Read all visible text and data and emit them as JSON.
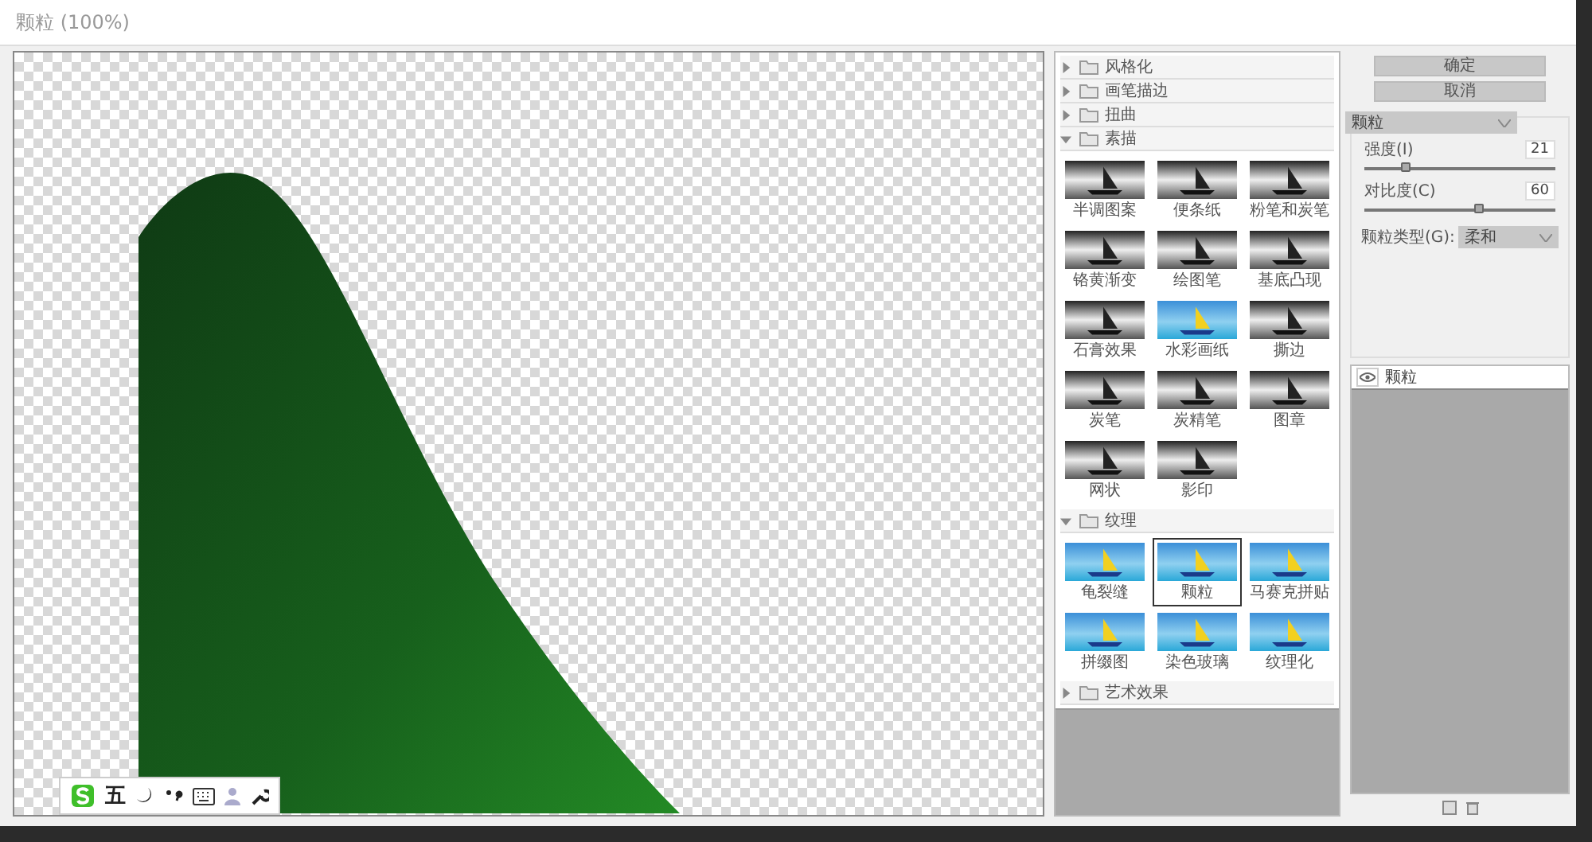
{
  "window": {
    "title": "颗粒 (100%)"
  },
  "filter_groups": [
    {
      "name": "风格化",
      "expanded": false
    },
    {
      "name": "画笔描边",
      "expanded": false
    },
    {
      "name": "扭曲",
      "expanded": false
    },
    {
      "name": "素描",
      "expanded": true,
      "items": [
        {
          "label": "半调图案",
          "kind": "mono",
          "selected": false
        },
        {
          "label": "便条纸",
          "kind": "mono",
          "selected": false
        },
        {
          "label": "粉笔和炭笔",
          "kind": "mono",
          "selected": false
        },
        {
          "label": "铬黄渐变",
          "kind": "mono",
          "selected": false
        },
        {
          "label": "绘图笔",
          "kind": "mono",
          "selected": false
        },
        {
          "label": "基底凸现",
          "kind": "mono",
          "selected": false
        },
        {
          "label": "石膏效果",
          "kind": "mono",
          "selected": false
        },
        {
          "label": "水彩画纸",
          "kind": "color",
          "selected": false
        },
        {
          "label": "撕边",
          "kind": "mono",
          "selected": false
        },
        {
          "label": "炭笔",
          "kind": "mono",
          "selected": false
        },
        {
          "label": "炭精笔",
          "kind": "mono",
          "selected": false
        },
        {
          "label": "图章",
          "kind": "mono",
          "selected": false
        },
        {
          "label": "网状",
          "kind": "mono",
          "selected": false
        },
        {
          "label": "影印",
          "kind": "mono",
          "selected": false
        }
      ]
    },
    {
      "name": "纹理",
      "expanded": true,
      "items": [
        {
          "label": "龟裂缝",
          "kind": "color",
          "selected": false
        },
        {
          "label": "颗粒",
          "kind": "color",
          "selected": true
        },
        {
          "label": "马赛克拼贴",
          "kind": "color",
          "selected": false
        },
        {
          "label": "拼缀图",
          "kind": "color",
          "selected": false
        },
        {
          "label": "染色玻璃",
          "kind": "color",
          "selected": false
        },
        {
          "label": "纹理化",
          "kind": "color",
          "selected": false
        }
      ]
    },
    {
      "name": "艺术效果",
      "expanded": false
    }
  ],
  "buttons": [
    "确定",
    "取消"
  ],
  "filter_select": "颗粒",
  "params": [
    {
      "label": "强度(I)",
      "value": "21",
      "level": 0.22
    },
    {
      "label": "对比度(C)",
      "value": "60",
      "level": 0.6
    }
  ],
  "grain_type": {
    "label": "颗粒类型(G):",
    "value": "柔和"
  },
  "layers": [
    {
      "name": "颗粒",
      "visible": true
    }
  ],
  "ime_toolbar": {
    "mode": "五"
  }
}
